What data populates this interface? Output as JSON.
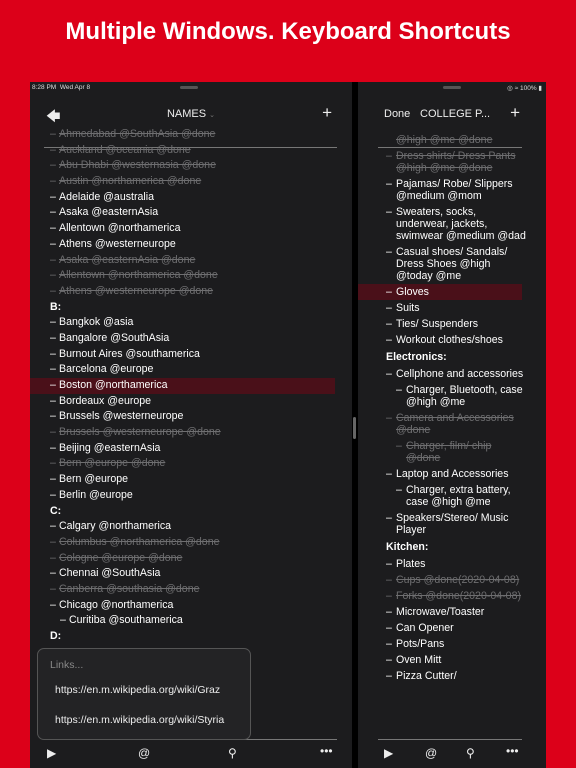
{
  "banner": {
    "title": "Multiple Windows. Keyboard Shortcuts"
  },
  "status": {
    "time": "8:28 PM",
    "date": "Wed Apr 8",
    "battery": "100%"
  },
  "left": {
    "back_icon": "arrow-left-icon",
    "title": "NAMES",
    "title_chevron": "⌄",
    "add_label": "+",
    "rows": [
      {
        "text": "Ahmedabad @SouthAsia @done",
        "type": "done"
      },
      {
        "text": "Auckland @oceania @done",
        "type": "done"
      },
      {
        "text": "Abu Dhabi @westernasia @done",
        "type": "done"
      },
      {
        "text": "Austin @northamerica @done",
        "type": "done"
      },
      {
        "text": "Adelaide @australia",
        "type": "normal"
      },
      {
        "text": "Asaka @easternAsia",
        "type": "normal"
      },
      {
        "text": "Allentown @northamerica",
        "type": "normal"
      },
      {
        "text": "Athens @westerneurope",
        "type": "normal"
      },
      {
        "text": "Asaka @easternAsia  @done",
        "type": "done"
      },
      {
        "text": "Allentown @northamerica  @done",
        "type": "done"
      },
      {
        "text": "Athens @westerneurope  @done",
        "type": "done"
      },
      {
        "text": "B:",
        "type": "hdr"
      },
      {
        "text": "Bangkok @asia",
        "type": "normal"
      },
      {
        "text": "Bangalore @SouthAsia",
        "type": "normal"
      },
      {
        "text": "Burnout Aires @southamerica",
        "type": "normal"
      },
      {
        "text": "Barcelona @europe",
        "type": "normal"
      },
      {
        "text": "Boston @northamerica",
        "type": "sel"
      },
      {
        "text": "Bordeaux @europe",
        "type": "normal"
      },
      {
        "text": "Brussels @westerneurope",
        "type": "normal"
      },
      {
        "text": "Brussels @westerneurope  @done",
        "type": "done"
      },
      {
        "text": "Beijing @easternAsia",
        "type": "normal"
      },
      {
        "text": "Bern @europe  @done",
        "type": "done"
      },
      {
        "text": "Bern @europe",
        "type": "normal"
      },
      {
        "text": "Berlin @europe",
        "type": "normal"
      },
      {
        "text": "C:",
        "type": "hdr"
      },
      {
        "text": "Calgary @northamerica",
        "type": "normal"
      },
      {
        "text": "Columbus @northamerica  @done",
        "type": "done"
      },
      {
        "text": "Cologne @europe  @done",
        "type": "done"
      },
      {
        "text": "Chennai @SouthAsia",
        "type": "normal"
      },
      {
        "text": "Canberra @southasia @done",
        "type": "done"
      },
      {
        "text": "Chicago @northamerica",
        "type": "normal"
      },
      {
        "text": "Curitiba @southamerica",
        "type": "ind"
      },
      {
        "text": "D:",
        "type": "hdr"
      }
    ],
    "popup": {
      "placeholder": "Links...",
      "links": [
        "https://en.m.wikipedia.org/wiki/Graz",
        "https://en.m.wikipedia.org/wiki/Styria"
      ]
    }
  },
  "right": {
    "done_label": "Done",
    "title": "COLLEGE P...",
    "add_label": "+",
    "items": [
      {
        "text": "@high @me @done",
        "type": "done cut"
      },
      {
        "text": "Dress shirts/ Dress Pants @high @me @done",
        "type": "done"
      },
      {
        "text": "Pajamas/ Robe/ Slippers @medium @mom",
        "type": "normal"
      },
      {
        "text": "Sweaters, socks, underwear, jackets, swimwear @medium @dad",
        "type": "normal"
      },
      {
        "text": "Casual shoes/ Sandals/ Dress Shoes @high @today @me",
        "type": "normal"
      },
      {
        "text": "Gloves",
        "type": "sel"
      },
      {
        "text": "Suits",
        "type": "normal"
      },
      {
        "text": "Ties/ Suspenders",
        "type": "normal"
      },
      {
        "text": "Workout clothes/shoes",
        "type": "normal"
      },
      {
        "text": "Electronics:",
        "type": "hdr"
      },
      {
        "text": "Cellphone and accessories",
        "type": "normal"
      },
      {
        "text": "Charger, Bluetooth, case @high @me",
        "type": "ind"
      },
      {
        "text": "Camera and Accessories @done",
        "type": "done"
      },
      {
        "text": "Charger, film/ chip @done",
        "type": "done ind"
      },
      {
        "text": "Laptop and Accessories",
        "type": "normal"
      },
      {
        "text": "Charger, extra battery, case @high @me",
        "type": "ind"
      },
      {
        "text": "Speakers/Stereo/ Music Player",
        "type": "normal"
      },
      {
        "text": "Kitchen:",
        "type": "hdr"
      },
      {
        "text": "Plates",
        "type": "normal"
      },
      {
        "text": "Cups @done(2020-04-08)",
        "type": "done"
      },
      {
        "text": "Forks @done(2020-04-08)",
        "type": "done"
      },
      {
        "text": "Microwave/Toaster",
        "type": "normal"
      },
      {
        "text": "Can Opener",
        "type": "normal"
      },
      {
        "text": "Pots/Pans",
        "type": "normal"
      },
      {
        "text": "Oven Mitt",
        "type": "normal"
      },
      {
        "text": "Pizza Cutter/",
        "type": "normal"
      }
    ]
  },
  "toolbar": {
    "play_icon": "play-circle-icon",
    "at_label": "@",
    "search_icon": "magnifier-icon",
    "more_label": "•••"
  }
}
